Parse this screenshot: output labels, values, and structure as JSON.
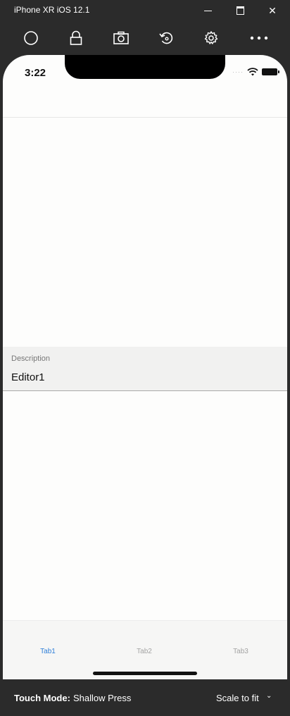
{
  "window": {
    "title": "iPhone XR iOS 12.1",
    "controls": {
      "minimize": "minimize",
      "maximize": "maximize",
      "close": "✕"
    }
  },
  "toolbar": {
    "items": [
      {
        "name": "home",
        "icon": "circle-icon"
      },
      {
        "name": "lock",
        "icon": "lock-icon"
      },
      {
        "name": "screenshot",
        "icon": "camera-icon"
      },
      {
        "name": "rotate",
        "icon": "rotate-icon"
      },
      {
        "name": "settings",
        "icon": "gear-icon"
      },
      {
        "name": "more",
        "icon": "more-icon"
      }
    ]
  },
  "device": {
    "status_time": "3:22",
    "status_dots": "····",
    "editor": {
      "label": "Description",
      "value": "Editor1"
    },
    "tabs": [
      {
        "label": "Tab1",
        "selected": true
      },
      {
        "label": "Tab2",
        "selected": false
      },
      {
        "label": "Tab3",
        "selected": false
      }
    ],
    "accent_color": "#2f7fd8"
  },
  "bottombar": {
    "touch_mode_label": "Touch Mode:",
    "touch_mode_value": "Shallow Press",
    "scale_label": "Scale to fit",
    "scale_chevron": "⌄"
  }
}
